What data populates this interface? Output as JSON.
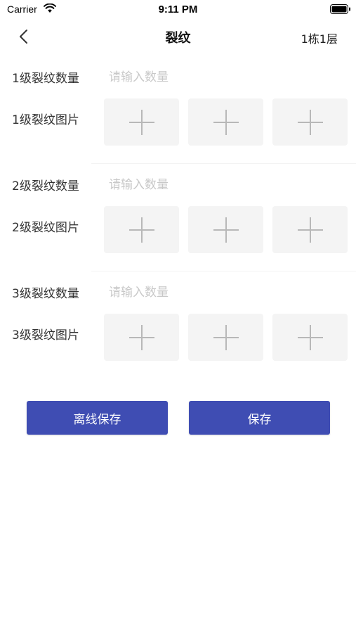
{
  "status_bar": {
    "carrier": "Carrier",
    "time": "9:11 PM"
  },
  "nav": {
    "title": "裂纹",
    "right_text": "1栋1层"
  },
  "sections": [
    {
      "count_label": "1级裂纹数量",
      "count_placeholder": "请输入数量",
      "count_value": "",
      "image_label": "1级裂纹图片"
    },
    {
      "count_label": "2级裂纹数量",
      "count_placeholder": "请输入数量",
      "count_value": "",
      "image_label": "2级裂纹图片"
    },
    {
      "count_label": "3级裂纹数量",
      "count_placeholder": "请输入数量",
      "count_value": "",
      "image_label": "3级裂纹图片"
    }
  ],
  "buttons": {
    "offline_save": "离线保存",
    "save": "保存"
  },
  "colors": {
    "primary": "#3f4db3",
    "photo_slot_bg": "#f4f4f4",
    "placeholder": "#c8c8c8"
  }
}
